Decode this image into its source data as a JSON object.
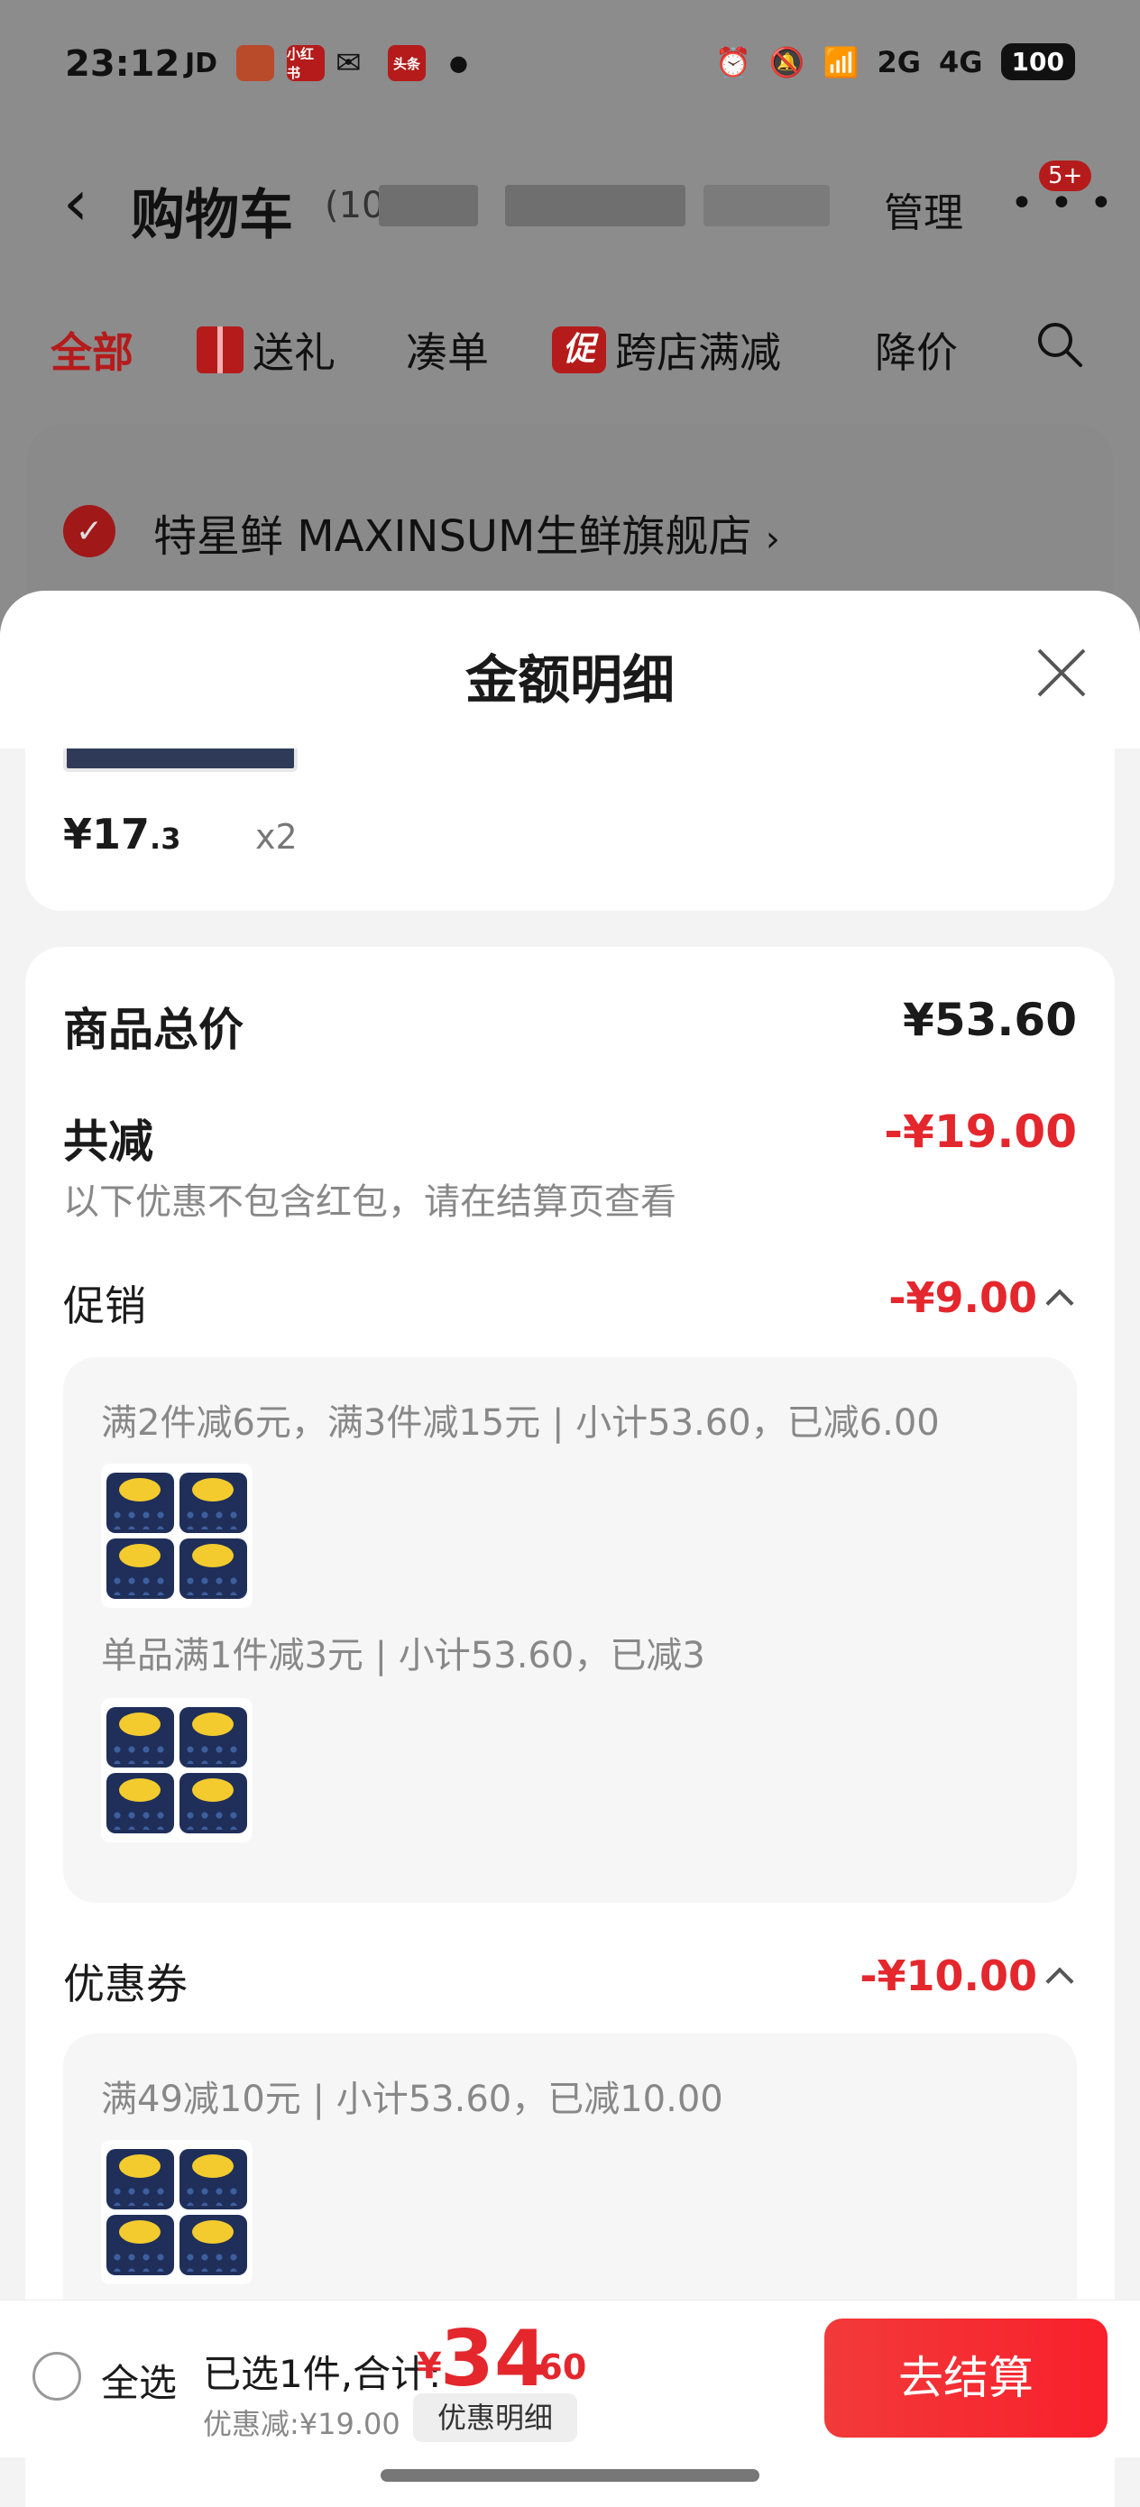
{
  "status_bar": {
    "time": "23:12",
    "apps": [
      "JD",
      "小红书",
      "头条"
    ],
    "network": [
      "2G",
      "4G"
    ],
    "battery": "100"
  },
  "cart_header": {
    "title": "购物车",
    "count_prefix": "(10",
    "manage": "管理",
    "more_badge": "5+"
  },
  "filter_tabs": [
    {
      "label": "全部",
      "active": true
    },
    {
      "label": "送礼",
      "icon": "gift-icon"
    },
    {
      "label": "凑单"
    },
    {
      "label": "跨店满减",
      "tag": "促"
    },
    {
      "label": "降价"
    }
  ],
  "store": {
    "name": "特星鲜 MAXINSUM生鲜旗舰店",
    "arrow": "›"
  },
  "sheet": {
    "title": "金额明细",
    "item": {
      "price_int": "¥17",
      "price_dec": ".3",
      "qty": "x2"
    },
    "goods_total_label": "商品总价",
    "goods_total_value": "¥53.60",
    "total_discount_label": "共减",
    "total_discount_value": "-¥19.00",
    "note": "以下优惠不包含红包，请在结算页查看",
    "promotion": {
      "label": "促销",
      "value": "-¥9.00",
      "rules": [
        "满2件减6元，满3件减15元 | 小计53.60，已减6.00",
        "单品满1件减3元 | 小计53.60，已减3"
      ]
    },
    "coupon": {
      "label": "优惠券",
      "value": "-¥10.00",
      "rules": [
        "满49减10元 | 小计53.60，已减10.00"
      ]
    }
  },
  "bottom_bar": {
    "select_all": "全选",
    "selected_summary": "已选1件,合计:",
    "total_currency": "¥",
    "total_int": "34",
    "total_dec": ".60",
    "discount_note": "优惠减:¥19.00",
    "discount_detail": "优惠明细",
    "checkout": "去结算"
  },
  "colors": {
    "accent_red": "#e4262d",
    "brand_red": "#b51b1b"
  }
}
